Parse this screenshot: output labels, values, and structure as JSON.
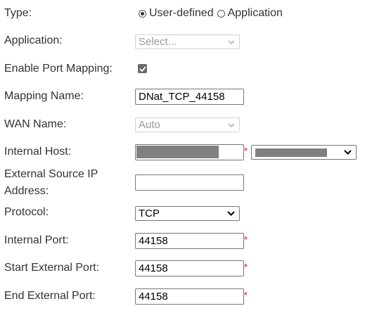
{
  "labels": {
    "type": "Type:",
    "application": "Application:",
    "enable_port_mapping": "Enable Port Mapping:",
    "mapping_name": "Mapping Name:",
    "wan_name": "WAN Name:",
    "internal_host": "Internal Host:",
    "external_source_ip_line1": "External Source IP",
    "external_source_ip_line2": "Address:",
    "protocol": "Protocol:",
    "internal_port": "Internal Port:",
    "start_external_port": "Start External Port:",
    "end_external_port": "End External Port:"
  },
  "type_options": [
    {
      "label": "User-defined",
      "selected": true
    },
    {
      "label": "Application",
      "selected": false
    }
  ],
  "application": {
    "selected": "Select...",
    "disabled": true
  },
  "enable_port_mapping": {
    "checked": true
  },
  "mapping_name": {
    "value": "DNat_TCP_44158"
  },
  "wan_name": {
    "selected": "Auto",
    "disabled": true
  },
  "internal_host": {
    "value": "",
    "required_mark": "*"
  },
  "external_source_ip": {
    "value": ""
  },
  "protocol": {
    "selected": "TCP"
  },
  "internal_port": {
    "value": "44158",
    "required_mark": "*"
  },
  "start_external_port": {
    "value": "44158",
    "required_mark": "*"
  },
  "end_external_port": {
    "value": "44158",
    "required_mark": "*"
  },
  "colors": {
    "required": "#e60012",
    "redaction": "#808080",
    "text": "#333333"
  }
}
